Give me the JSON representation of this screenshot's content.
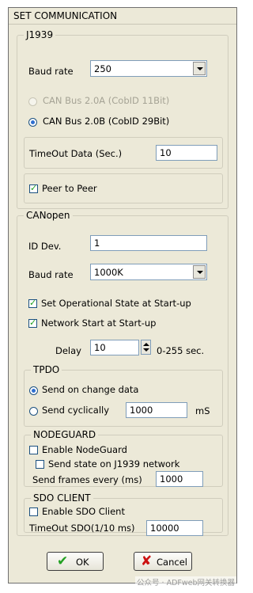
{
  "window": {
    "title": "SET COMMUNICATION"
  },
  "j1939": {
    "legend": "J1939",
    "baud_label": "Baud rate",
    "baud_value": "250",
    "can_a_label": "CAN Bus 2.0A (CobID 11Bit)",
    "can_b_label": "CAN Bus 2.0B (CobID 29Bit)",
    "timeout_label": "TimeOut Data  (Sec.)",
    "timeout_value": "10",
    "peer_label": "Peer to Peer"
  },
  "canopen": {
    "legend": "CANopen",
    "id_label": "ID Dev.",
    "id_value": "1",
    "baud_label": "Baud rate",
    "baud_value": "1000K",
    "set_operational_label": "Set Operational State at Start-up",
    "network_start_label": "Network Start at Start-up",
    "delay_label": "Delay",
    "delay_value": "10",
    "delay_range": "0-255 sec."
  },
  "tpdo": {
    "legend": "TPDO",
    "send_change_label": "Send on change data",
    "send_cyclic_label": "Send cyclically",
    "cyclic_value": "1000",
    "cyclic_unit": "mS"
  },
  "nodeguard": {
    "legend": "NODEGUARD",
    "enable_label": "Enable NodeGuard",
    "send_state_label": "Send state on J1939 network",
    "frames_label": "Send frames every (ms)",
    "frames_value": "1000"
  },
  "sdo": {
    "legend": "SDO CLIENT",
    "enable_label": "Enable SDO Client",
    "timeout_label": "TimeOut SDO(1/10 ms)",
    "timeout_value": "10000"
  },
  "buttons": {
    "ok": "OK",
    "cancel": "Cancel"
  },
  "watermark": "公众号 · ADFweb网关转换器",
  "colors": {
    "ok_icon": "#22a022",
    "cancel_icon": "#cc1111",
    "checkmark": "#21a121"
  }
}
